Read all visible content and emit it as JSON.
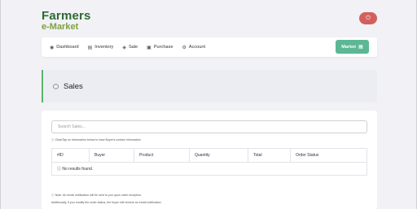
{
  "logo": {
    "line1": "Farmers",
    "line2": "e-Market"
  },
  "header": {
    "power_icon": "power-icon"
  },
  "nav": {
    "items": [
      {
        "label": "Dashboard",
        "icon": "dashboard-icon"
      },
      {
        "label": "Inventory",
        "icon": "inventory-icon"
      },
      {
        "label": "Sale",
        "icon": "sale-icon"
      },
      {
        "label": "Purchase",
        "icon": "purchase-icon"
      },
      {
        "label": "Account",
        "icon": "account-icon"
      }
    ],
    "market_button": {
      "label": "Market",
      "icon": "store-icon"
    }
  },
  "page": {
    "title": "Sales",
    "title_icon": "box-icon"
  },
  "search": {
    "placeholder": "Search Sales..."
  },
  "hint_text": "ⓘ Click/Tap on information below to view Buyer's contact information",
  "table": {
    "columns": [
      "#ID",
      "Buyer",
      "Product",
      "Quantity",
      "Total",
      "Order Status"
    ],
    "empty_text": "ⓘ No results found."
  },
  "notes": {
    "line1": "ⓘ Note: An email notification will be sent to you upon order reception.",
    "line2": "Additionally, if you modify the order status, the buyer will receive an email notification."
  },
  "colors": {
    "brand_green": "#2f6a32",
    "accent_green": "#5cb894",
    "danger": "#d35f5f"
  }
}
